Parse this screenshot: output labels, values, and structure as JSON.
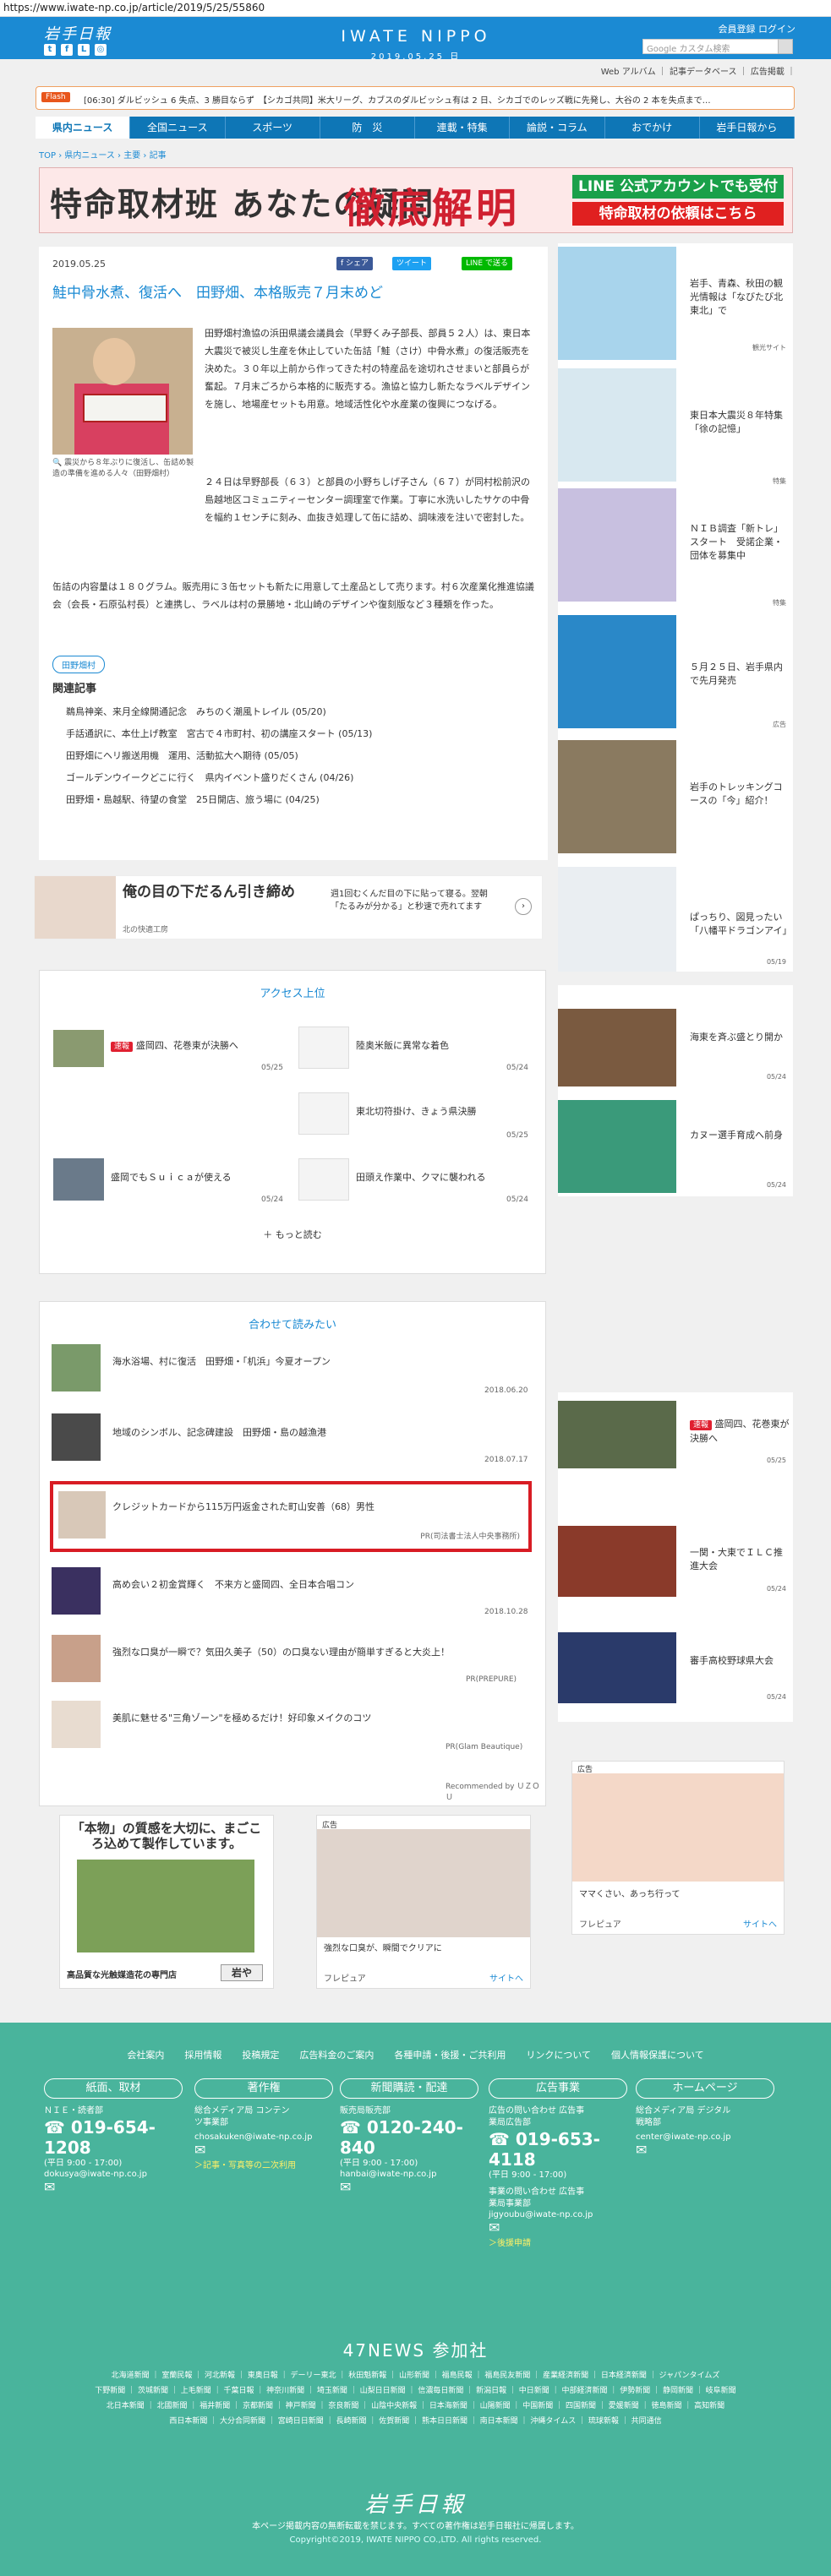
{
  "url": "https://www.iwate-np.co.jp/article/2019/5/25/55860",
  "header": {
    "logo": "岩手日報",
    "brand": "IWATE NIPPO",
    "date": "2019.05.25 日",
    "members": "会員登録 ログイン",
    "search_placeholder": "Google カスタム検索",
    "links": "Web アルバム ｜ 記事データベース ｜ 広告掲載 ｜"
  },
  "flash": {
    "tag": "Flash",
    "text": "[06:30] ダルビッシュ 6 失点、3 勝目ならず　【シカゴ共同】米大リーグ、カブスのダルビッシュ有は 2 日、シカゴでのレッズ戦に先発し、大谷の 2 本を失点まで…"
  },
  "nav": [
    "県内ニュース",
    "全国ニュース",
    "スポーツ",
    "防　災",
    "連載・特集",
    "論説・コラム",
    "おでかけ",
    "岩手日報から"
  ],
  "breadcrumb": "TOP › 県内ニュース › 主要 › 記事",
  "banner": {
    "left": "特命取材班 あなたの疑問",
    "big": "徹底解明",
    "r1": "LINE 公式アカウントでも受付",
    "r2": "特命取材の依頼はこちら"
  },
  "article": {
    "date": "2019.05.25",
    "share_fb": "f シェア",
    "share_tw": "ツイート",
    "share_line": "LINE で送る",
    "title": "鮭中骨水煮、復活へ　田野畑、本格販売７月末めど",
    "caption": "🔍 震災から８年ぶりに復活し、缶詰め製造の準備を進める人々（田野畑村）",
    "p1": [
      "田野畑村漁協の浜田県議会議員会（早野くみ子部長、部員５２人）は、東日本大震災で被災し生産を休止していた缶詰「鮭（さけ）中骨水煮」の復活販売を決めた。３０年以上前から作ってきた村の特産品を途切れさせまいと部員らが奮起。７月末ごろから本格的に販売する。漁協と協力し新たなラベルデザインを施し、地場産セットも用意。地域活性化や水産業の復興につなげる。",
      "２４日は早野部長（６３）と部員の小野ちしげ子さん（６７）が同村松前沢の島越地区コミュニティーセンター調理室で作業。丁寧に水洗いしたサケの中骨を幅約１センチに刻み、血抜き処理して缶に詰め、調味液を注いで密封した。",
      "缶詰の内容量は１８０グラム。販売用に３缶セットも新たに用意して土産品として売ります。村６次産業化推進協議会（会長・石原弘村長）と連携し、ラベルは村の景勝地・北山崎のデザインや復刻版など３種類を作った。"
    ],
    "tag": "田野畑村",
    "related_heading": "関連記事",
    "related": [
      "鵜鳥神楽、来月全線開通記念　みちのく潮風トレイル (05/20)",
      "手話通訳に、本仕上げ教室　宮古で４市町村、初の講座スタート (05/13)",
      "田野畑にヘリ搬送用機　運用、活動拡大へ期待 (05/05)",
      "ゴールデンウイークどこに行く　県内イベント盛りだくさん (04/26)",
      "田野畑・島越駅、待望の食堂　25日開店、旅う場に (04/25)"
    ]
  },
  "ad1": {
    "head": "俺の目の下だるん引き締め",
    "sub": "北の快適工房",
    "text": "週1回むくんだ目の下に貼って寝る。翌朝「たるみが分かる」と秒速で売れてます"
  },
  "access": {
    "title": "アクセス上位",
    "items": [
      {
        "badge": "速報",
        "title": "盛岡四、花巻東が決勝へ",
        "date": "05/25"
      },
      {
        "badge": "",
        "title": "陸奥米飯に異常な着色",
        "date": "05/24"
      },
      {
        "badge": "",
        "title": "東北切符掛け、きょう県決勝",
        "date": "05/25"
      },
      {
        "badge": "",
        "title": "盛岡でもＳｕｉｃａが使える",
        "date": "05/24"
      },
      {
        "badge": "",
        "title": "田頭え作業中、クマに襲われる",
        "date": "05/24"
      }
    ],
    "more": "＋ もっと読む"
  },
  "recommend": {
    "title": "合わせて読みたい",
    "items": [
      {
        "title": "海水浴場、村に復活　田野畑・「机浜」今夏オープン",
        "date": "2018.06.20"
      },
      {
        "title": "地域のシンボル、記念碑建設　田野畑・島の越漁港",
        "date": "2018.07.17"
      },
      {
        "title": "クレジットカードから115万円返金された町山安善（68）男性",
        "date": "PR(司法書士法人中央事務所)"
      },
      {
        "title": "高め会い２初金賞輝く　不来方と盛岡四、全日本合唱コン",
        "date": "2018.10.28"
      },
      {
        "title": "強烈な口臭が一瞬で？気田久美子（50）の口臭ない理由が簡単すぎると大炎上！",
        "date": "PR(PREPURE)"
      },
      {
        "title": "美肌に魅せる\"三角ゾーン\"を極めるだけ！好印象メイクのコツ",
        "date": "PR(Glam Beautique)"
      }
    ],
    "powered": "Recommended by ＵＺＯＵ"
  },
  "ad2": {
    "top": "「本物」の質感を大切に、まごころ込めて製作しています。",
    "bottom": "高品質な光触媒造花の専門店",
    "btn": "岩や"
  },
  "ad3": {
    "label": "広告",
    "text": "強烈な口臭が、瞬間でクリアに",
    "src": "フレピュア",
    "site": "サイトへ"
  },
  "sidebar": {
    "items": [
      {
        "title": "岩手、青森、秋田の観光情報は「なびたび北東北」で",
        "src": "観光サイト"
      },
      {
        "title": "東日本大震災８年特集「徐の記憶」",
        "src": "特集"
      },
      {
        "title": "ＮＩＢ調査「新トレ」スタート　受諾企業・団体を募集中",
        "src": "特集"
      },
      {
        "title": "５月２５日、岩手県内で先月発売",
        "src": "広告"
      },
      {
        "title": "岩手のトレッキングコースの「今」紹介！",
        "src": ""
      },
      {
        "title": "ぱっちり、図見ったい「八幡平ドラゴンアイ」",
        "src": "05/19"
      },
      {
        "title": "海東を斉ぶ盛とり開か",
        "src": "05/24"
      },
      {
        "title": "カヌー選手育成へ前身",
        "src": "05/24"
      }
    ],
    "bottom": [
      {
        "badge": "速報",
        "title": "盛岡四、花巻東が決勝へ",
        "date": "05/25"
      },
      {
        "badge": "",
        "title": "一関・大東でＩＬＣ推進大会",
        "date": "05/24"
      },
      {
        "badge": "",
        "title": "審手高校野球県大会",
        "date": "05/24"
      }
    ],
    "ad_label": "広告",
    "ad_text": "ママくさい、あっち行って",
    "ad_src": "フレピュア",
    "ad_site": "サイトへ"
  },
  "footer": {
    "links": [
      "会社案内",
      "採用情報",
      "投稿規定",
      "広告料金のご案内",
      "各種申請・後援・ご共利用",
      "リンクについて",
      "個人情報保護について"
    ],
    "cols": [
      {
        "head": "紙面、取材",
        "sub": "ＮＩＥ・読者部",
        "phone": "019-654-1208",
        "hours": "(平日 9:00 - 17:00)",
        "mail": "dokusya@iwate-np.co.jp",
        "note": ""
      },
      {
        "head": "著作権",
        "sub": "総合メディア局 コンテンツ事業部",
        "phone": "",
        "hours": "",
        "mail": "chosakuken@iwate-np.co.jp",
        "note": "＞記事・写真等の二次利用"
      },
      {
        "head": "新聞購読・配達",
        "sub": "販売局販売部",
        "phone": "0120-240-840",
        "hours": "(平日 9:00 - 17:00)",
        "mail": "hanbai@iwate-np.co.jp",
        "note": ""
      },
      {
        "head": "広告事業",
        "sub": "広告の問い合わせ 広告事業局広告部",
        "phone": "019-653-4118",
        "hours": "(平日 9:00 - 17:00)",
        "mail": "jigyoubu@iwate-np.co.jp",
        "note": "＞後援申請"
      },
      {
        "head": "ホームページ",
        "sub": "総合メディア局 デジタル戦略部",
        "phone": "",
        "hours": "",
        "mail": "center@iwate-np.co.jp",
        "note": ""
      }
    ],
    "sub2": "事業の問い合わせ 広告事業局事業部",
    "title47": "47NEWS 参加社",
    "papers": [
      "北海道新聞 ｜ 室蘭民報 ｜ 河北新報 ｜ 東奥日報 ｜ デーリー東北 ｜ 秋田魁新報 ｜ 山形新聞 ｜ 福島民報 ｜ 福島民友新聞 ｜ 産業経済新聞 ｜ 日本経済新聞 ｜ ジャパンタイムズ",
      "下野新聞 ｜ 茨城新聞 ｜ 上毛新聞 ｜ 千葉日報 ｜ 神奈川新聞 ｜ 埼玉新聞 ｜ 山梨日日新聞 ｜ 信濃毎日新聞 ｜ 新潟日報 ｜ 中日新聞 ｜ 中部経済新聞 ｜ 伊勢新聞 ｜ 静岡新聞 ｜ 岐阜新聞",
      "北日本新聞 ｜ 北國新聞 ｜ 福井新聞 ｜ 京都新聞 ｜ 神戸新聞 ｜ 奈良新聞 ｜ 山陰中央新報 ｜ 日本海新聞 ｜ 山陽新聞 ｜ 中国新聞 ｜ 四国新聞 ｜ 愛媛新聞 ｜ 徳島新聞 ｜ 高知新聞",
      "西日本新聞 ｜ 大分合同新聞 ｜ 宮崎日日新聞 ｜ 長崎新聞 ｜ 佐賀新聞 ｜ 熊本日日新聞 ｜ 南日本新聞 ｜ 沖縄タイムス ｜ 琉球新報 ｜ 共同通信"
    ],
    "logo": "岩手日報",
    "copy1": "本ページ掲載内容の無断転載を禁じます。すべての著作権は岩手日報社に帰属します。",
    "copy2": "Copyright©2019, IWATE NIPPO CO.,LTD. All rights reserved."
  }
}
